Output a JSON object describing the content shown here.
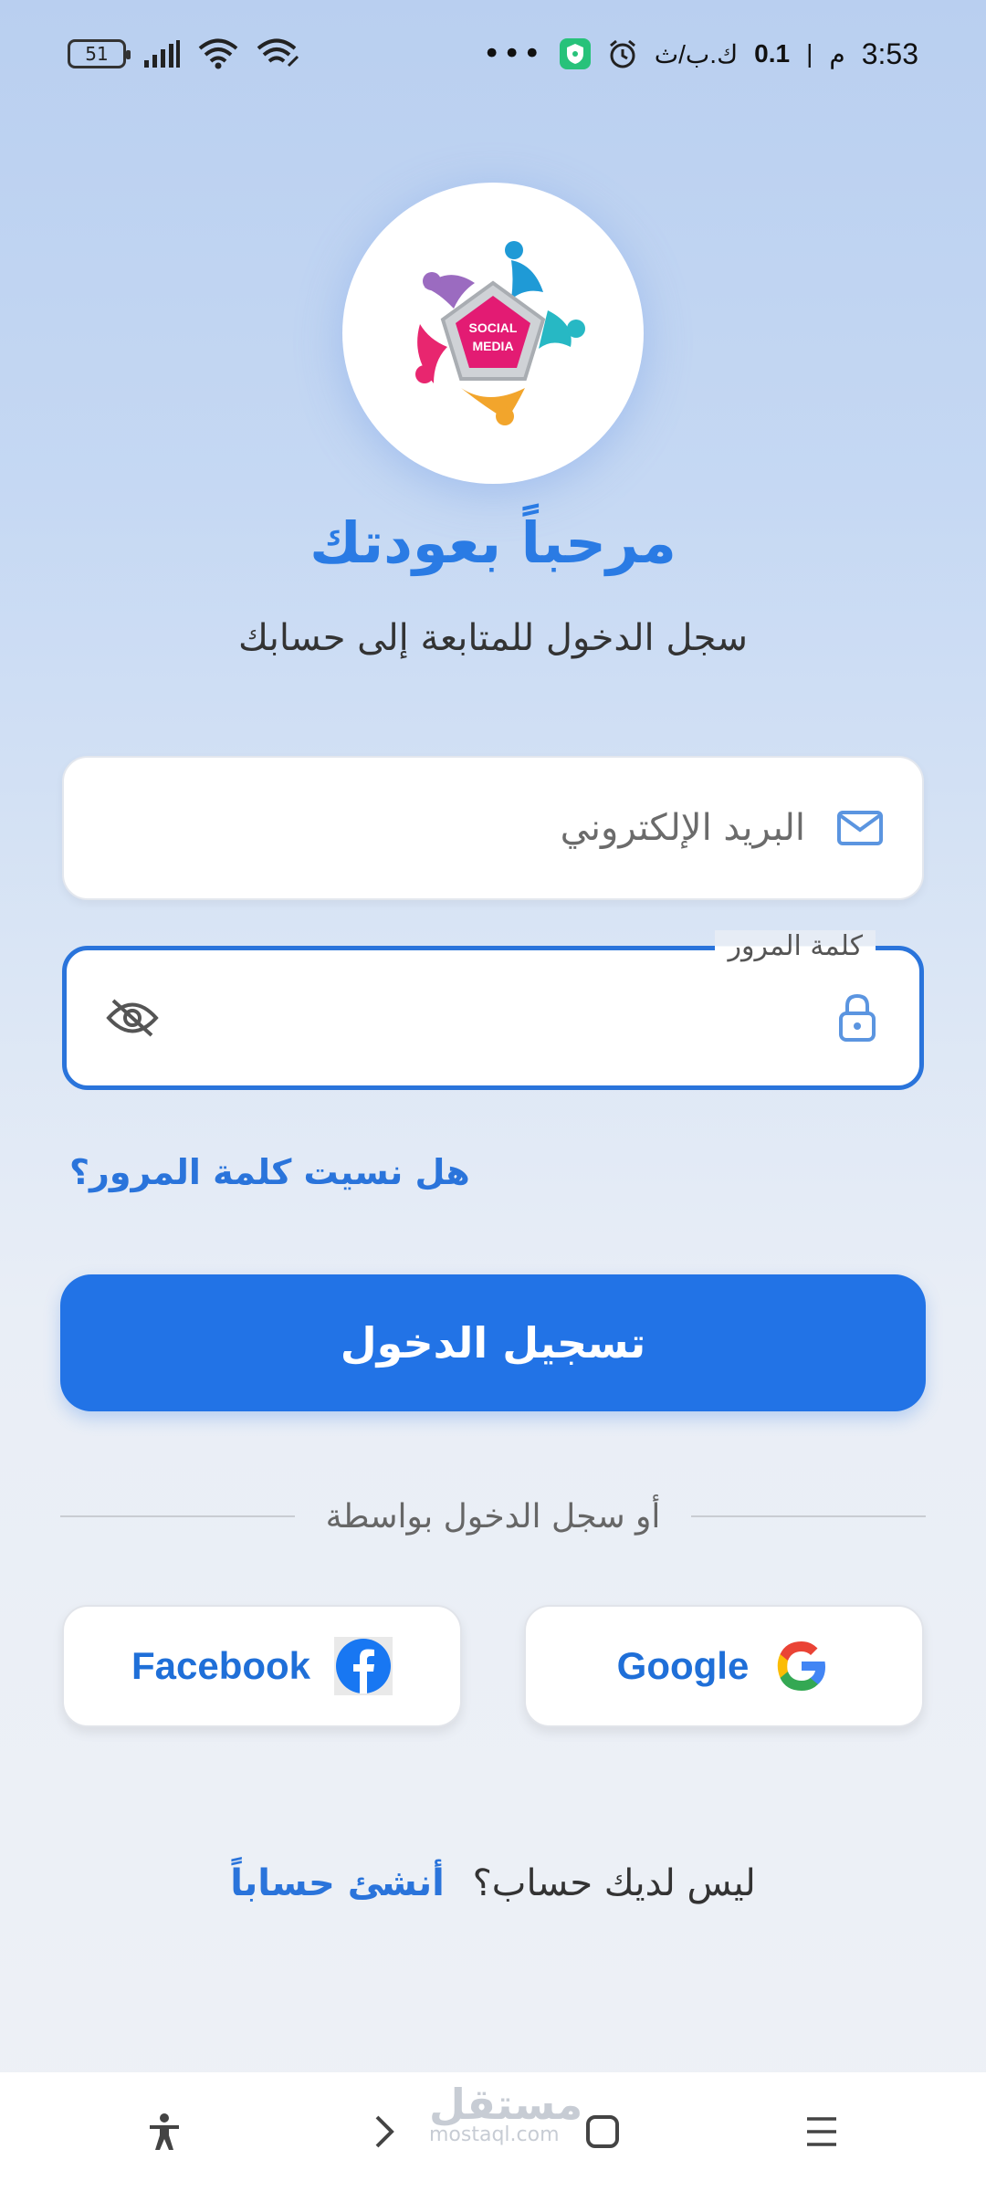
{
  "status_bar": {
    "battery": "51",
    "time": "3:53",
    "period": "م",
    "speed": "0.1",
    "speed_unit": "ك.ب/ث",
    "more": "•••"
  },
  "header": {
    "welcome": "مرحباً بعودتك",
    "subtitle": "سجل الدخول للمتابعة إلى حسابك"
  },
  "form": {
    "email_placeholder": "البريد الإلكتروني",
    "password_label": "كلمة المرور",
    "password_value": "",
    "forgot_password": "هل نسيت كلمة المرور؟",
    "login_button": "تسجيل الدخول"
  },
  "social": {
    "divider_text": "أو سجل الدخول بواسطة",
    "facebook": "Facebook",
    "google": "Google"
  },
  "signup": {
    "prompt": "ليس لديك حساب؟",
    "link": "أنشئ حساباً"
  },
  "watermark": {
    "arabic": "مستقل",
    "latin": "mostaql.com"
  },
  "colors": {
    "accent": "#2273e6",
    "link": "#2a74db",
    "title": "#2a7be4"
  }
}
